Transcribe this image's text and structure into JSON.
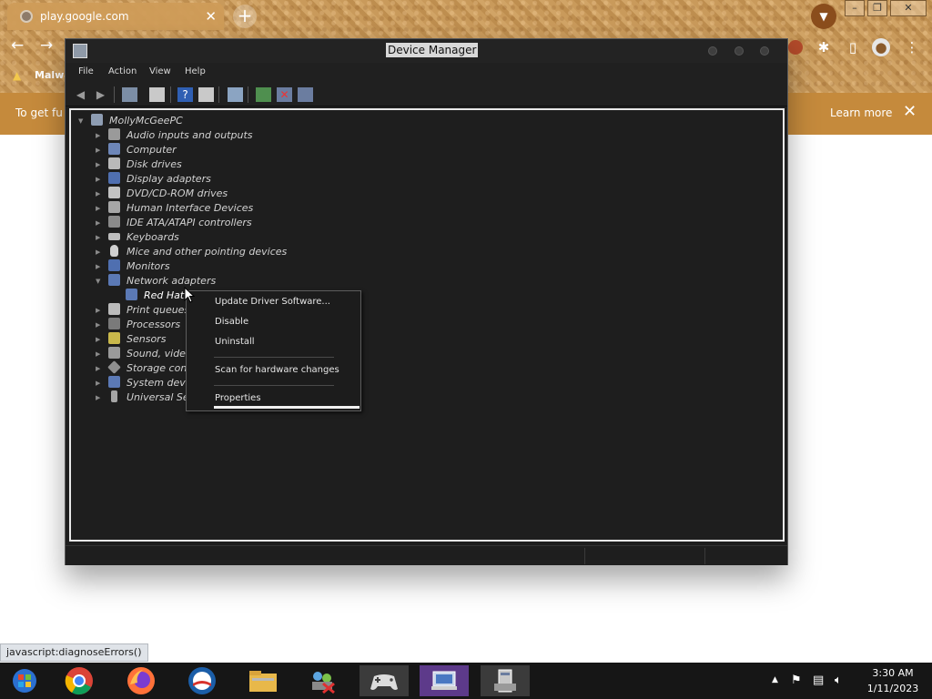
{
  "browser": {
    "tab_title": "play.google.com",
    "tab_close": "✕",
    "new_tab": "+",
    "bookmark_label": "Malwa",
    "infobar_text": "To get fu",
    "infobar_learn_more": "Learn more",
    "infobar_close": "✕",
    "status_link": "javascript:diagnoseErrors()"
  },
  "device_manager": {
    "title": "Device Manager",
    "menu": [
      "File",
      "Action",
      "View",
      "Help"
    ],
    "root": "MollyMcGeePC",
    "categories": [
      {
        "label": "Audio inputs and outputs",
        "icon": "speaker-icon"
      },
      {
        "label": "Computer",
        "icon": "computer-icon"
      },
      {
        "label": "Disk drives",
        "icon": "disk-icon"
      },
      {
        "label": "Display adapters",
        "icon": "display-icon"
      },
      {
        "label": "DVD/CD-ROM drives",
        "icon": "dvd-icon"
      },
      {
        "label": "Human Interface Devices",
        "icon": "hid-icon"
      },
      {
        "label": "IDE ATA/ATAPI controllers",
        "icon": "ide-icon"
      },
      {
        "label": "Keyboards",
        "icon": "keyboard-icon"
      },
      {
        "label": "Mice and other pointing devices",
        "icon": "mouse-icon"
      },
      {
        "label": "Monitors",
        "icon": "monitor-icon"
      },
      {
        "label": "Network adapters",
        "icon": "network-icon"
      },
      {
        "label": "Red Hat",
        "icon": "network-adapter-icon"
      },
      {
        "label": "Print queues",
        "icon": "printer-icon"
      },
      {
        "label": "Processors",
        "icon": "processor-icon"
      },
      {
        "label": "Sensors",
        "icon": "sensor-icon"
      },
      {
        "label": "Sound, video",
        "icon": "sound-icon"
      },
      {
        "label": "Storage contr",
        "icon": "storage-icon"
      },
      {
        "label": "System devic",
        "icon": "system-icon"
      },
      {
        "label": "Universal Ser",
        "icon": "usb-icon"
      }
    ]
  },
  "context_menu": {
    "update": "Update Driver Software...",
    "disable": "Disable",
    "uninstall": "Uninstall",
    "scan": "Scan for hardware changes",
    "properties": "Properties"
  },
  "taskbar": {
    "time": "3:30 AM",
    "date": "1/11/2023"
  },
  "colors": {
    "window_bg": "#1e1e1e",
    "infobar": "#c58a3c",
    "taskbar": "#161616"
  }
}
